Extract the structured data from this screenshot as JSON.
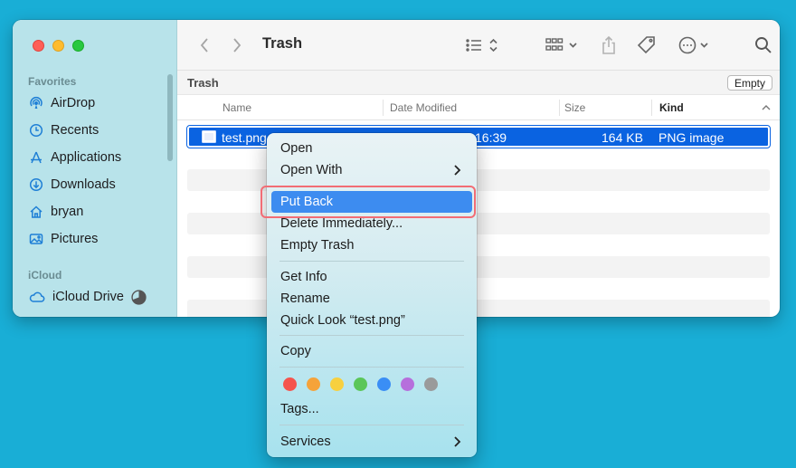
{
  "window": {
    "title": "Trash",
    "path_label": "Trash",
    "empty_button": "Empty"
  },
  "sidebar": {
    "favorites_label": "Favorites",
    "items": [
      {
        "label": "AirDrop",
        "icon": "airdrop-icon"
      },
      {
        "label": "Recents",
        "icon": "clock-icon"
      },
      {
        "label": "Applications",
        "icon": "applications-icon"
      },
      {
        "label": "Downloads",
        "icon": "download-icon"
      },
      {
        "label": "bryan",
        "icon": "home-icon"
      },
      {
        "label": "Pictures",
        "icon": "pictures-icon"
      }
    ],
    "icloud_label": "iCloud",
    "icloud_item": {
      "label": "iCloud Drive",
      "icon": "icloud-icon",
      "status_icon": "sync-pie-icon"
    }
  },
  "columns": {
    "name": "Name",
    "date": "Date Modified",
    "size": "Size",
    "kind": "Kind"
  },
  "file": {
    "name": "test.png",
    "time": "16:39",
    "size": "164 KB",
    "kind": "PNG image"
  },
  "menu": {
    "open": "Open",
    "open_with": "Open With",
    "put_back": "Put Back",
    "delete_immediately": "Delete Immediately...",
    "empty_trash": "Empty Trash",
    "get_info": "Get Info",
    "rename": "Rename",
    "quick_look": "Quick Look “test.png”",
    "copy": "Copy",
    "tags": "Tags...",
    "services": "Services"
  },
  "tag_colors": [
    "#f5544d",
    "#f5a33a",
    "#f7d03f",
    "#5bc658",
    "#3a8ef5",
    "#b66fdc",
    "#9a9a9a"
  ],
  "accent": "#0a63e1",
  "highlight_outline": "#f26d75"
}
